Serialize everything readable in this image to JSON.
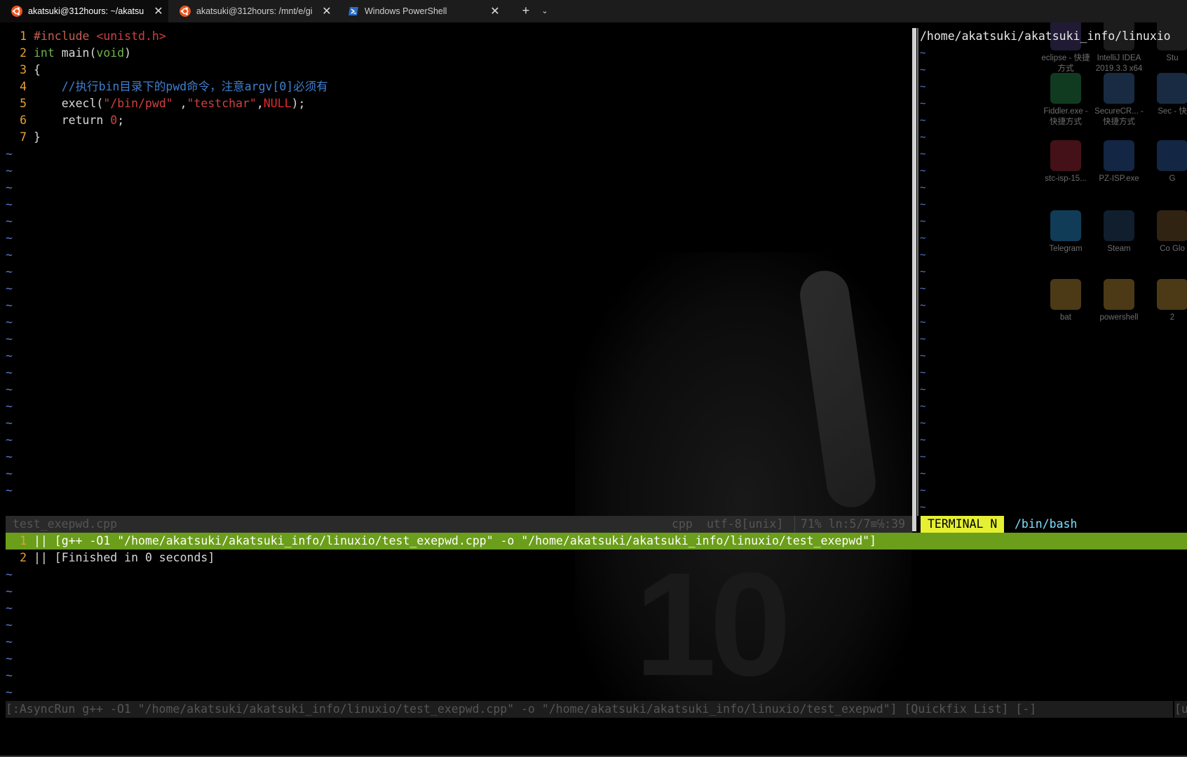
{
  "tabs": [
    {
      "label": "akatsuki@312hours: ~/akatsu",
      "active": true
    },
    {
      "label": "akatsuki@312hours: /mnt/e/gi",
      "active": false
    },
    {
      "label": "Windows PowerShell",
      "active": false
    }
  ],
  "tab_close_glyph": "✕",
  "new_tab_glyph": "+",
  "tab_dropdown_glyph": "⌄",
  "editor": {
    "lines": [
      {
        "num": "1",
        "parts": [
          [
            "#include ",
            "c-prep"
          ],
          [
            "<unistd.h>",
            "c-str"
          ]
        ]
      },
      {
        "num": "2",
        "parts": [
          [
            "int",
            "c-kw"
          ],
          [
            " main(",
            ""
          ],
          [
            "void",
            "c-kw"
          ],
          [
            ")",
            ""
          ]
        ]
      },
      {
        "num": "3",
        "parts": [
          [
            "{",
            ""
          ]
        ]
      },
      {
        "num": "4",
        "parts": [
          [
            "    //执行bin目录下的pwd命令，注意argv[0]必须有",
            "c-com"
          ]
        ]
      },
      {
        "num": "5",
        "parts": [
          [
            "    execl(",
            ""
          ],
          [
            "\"/bin/pwd\"",
            "c-str"
          ],
          [
            " ,",
            ""
          ],
          [
            "\"testchar\"",
            "c-str"
          ],
          [
            ",",
            ""
          ],
          [
            "NULL",
            "c-null"
          ],
          [
            ");",
            ""
          ]
        ]
      },
      {
        "num": "6",
        "parts": [
          [
            "    return ",
            ""
          ],
          [
            "0",
            "c-num"
          ],
          [
            ";",
            ""
          ]
        ]
      },
      {
        "num": "7",
        "parts": [
          [
            "}",
            ""
          ]
        ]
      }
    ],
    "tilde": "~"
  },
  "terminal": {
    "cwd": "/home/akatsuki/akatsuki_info/linuxio",
    "badge": "TERMINAL  N",
    "shell": "/bin/bash"
  },
  "status": {
    "filename": "test_exepwd.cpp",
    "filetype": "cpp",
    "encoding": "utf-8[unix]",
    "position": "71%  ln:5/7≡℅:39"
  },
  "quickfix": {
    "lines": [
      {
        "num": "1",
        "text": "|| [g++ -O1 \"/home/akatsuki/akatsuki_info/linuxio/test_exepwd.cpp\" -o \"/home/akatsuki/akatsuki_info/linuxio/test_exepwd\"]"
      },
      {
        "num": "2",
        "text": "|| [Finished in 0 seconds]"
      }
    ],
    "status": "[:AsyncRun g++ -O1 \"/home/akatsuki/akatsuki_info/linuxio/test_exepwd.cpp\" -o \"/home/akatsuki/akatsuki_info/linuxio/test_exepwd\"] [Quickfix List] [-]",
    "status_tail": "[u"
  },
  "desktop_icons": [
    {
      "label": "eclipse - 快捷方式",
      "color": "#3a3060"
    },
    {
      "label": "IntelliJ IDEA 2019.3.3 x64",
      "color": "#333"
    },
    {
      "label": "Stu",
      "color": "#333"
    },
    {
      "label": "Fiddler.exe - 快捷方式",
      "color": "#1f6b3a"
    },
    {
      "label": "SecureCR... - 快捷方式",
      "color": "#2d4f78"
    },
    {
      "label": "Sec - 快",
      "color": "#2d4f78"
    },
    {
      "label": "stc-isp-15...",
      "color": "#7a1f2a"
    },
    {
      "label": "PZ-ISP.exe",
      "color": "#23457a"
    },
    {
      "label": "G",
      "color": "#23457a"
    },
    {
      "label": "Telegram",
      "color": "#1f6ea0"
    },
    {
      "label": "Steam",
      "color": "#1d3752"
    },
    {
      "label": "Co Glo",
      "color": "#5a4020"
    },
    {
      "label": "bat",
      "color": "#8a6a2a"
    },
    {
      "label": "powershell",
      "color": "#8a6a2a"
    },
    {
      "label": "2",
      "color": "#8a6a2a"
    }
  ],
  "colors": {
    "tab_active_bg": "#0c0c0c",
    "tab_bar_bg": "#1c1c1c",
    "quickfix_highlight": "#6b9e1a",
    "terminal_badge": "#e6f032",
    "line_number": "#e5a234",
    "tilde": "#5577cc"
  }
}
